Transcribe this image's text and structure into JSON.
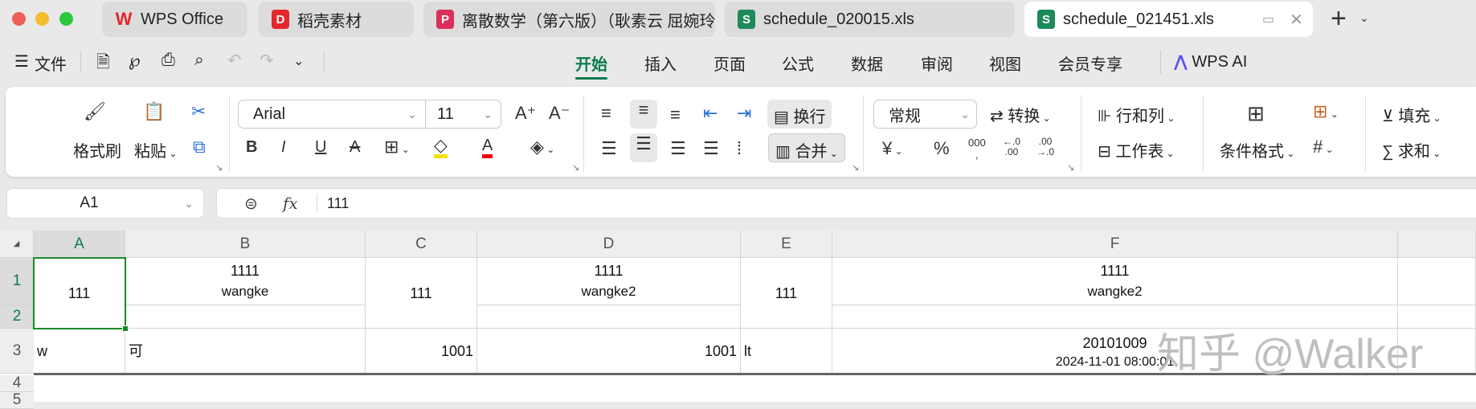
{
  "window": {
    "traffic_lights": [
      "#ee5f57",
      "#f5bd2f",
      "#2bc840"
    ]
  },
  "tabs": [
    {
      "label": "WPS Office",
      "icon": "W",
      "color": "#e5262a"
    },
    {
      "label": "稻壳素材",
      "icon": "D",
      "color": "#e5262a"
    },
    {
      "label": "离散数学（第六版）（耿素云 屈婉玲",
      "icon": "P",
      "color": "#d8305a"
    },
    {
      "label": "schedule_020015.xls",
      "icon": "S",
      "color": "#1d8a5a"
    },
    {
      "label": "schedule_021451.xls",
      "icon": "S",
      "color": "#1d8a5a",
      "active": true
    }
  ],
  "new_tab": "+",
  "menu": {
    "file": "文件",
    "tabs": [
      "开始",
      "插入",
      "页面",
      "公式",
      "数据",
      "审阅",
      "视图",
      "会员专享"
    ],
    "active": "开始",
    "ai": "WPS AI",
    "accent": "#0b7a4e"
  },
  "ribbon": {
    "format_painter": "格式刷",
    "paste": "粘贴",
    "font_name": "Arial",
    "font_size": "11",
    "wrap": "换行",
    "merge": "合并",
    "number_format": "常规",
    "convert": "转换",
    "rows_cols": "行和列",
    "worksheet": "工作表",
    "cond_format": "条件格式",
    "fill": "填充",
    "sum": "求和"
  },
  "formula_bar": {
    "name_box": "A1",
    "fx": "fx",
    "value": "111"
  },
  "sheet": {
    "columns": [
      "A",
      "B",
      "C",
      "D",
      "E",
      "F"
    ],
    "rows": [
      "1",
      "2",
      "3",
      "4",
      "5"
    ],
    "cells": {
      "A1": "111",
      "B1_line1": "1111",
      "B1_line2": "wangke",
      "C1": "111",
      "D1_line1": "1111",
      "D1_line2": "wangke2",
      "E1": "111",
      "F1_line1": "1111",
      "F1_line2": "wangke2",
      "A3": "w",
      "B3": "可",
      "C3": "1001",
      "D3": "1001",
      "E3": "lt",
      "F3_line1": "20101009",
      "F3_line2": "2024-11-01 08:00:01"
    },
    "selection_color": "#1a8a2a"
  },
  "watermark": "知乎 @Walker"
}
